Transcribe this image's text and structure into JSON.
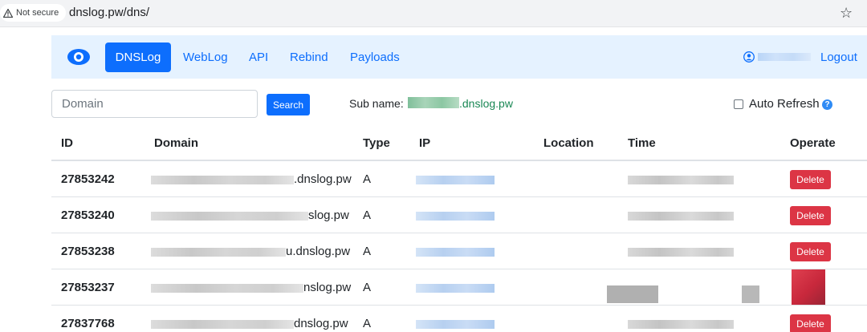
{
  "browser": {
    "security_label": "Not secure",
    "url": "dnslog.pw/dns/"
  },
  "navbar": {
    "brand_icon": "eye-icon",
    "active": "DNSLog",
    "links": [
      "WebLog",
      "API",
      "Rebind",
      "Payloads"
    ],
    "logout": "Logout",
    "accent": "#0d6efd",
    "background": "#e5f2ff"
  },
  "search": {
    "placeholder": "Domain",
    "value": "",
    "button": "Search",
    "sub_name_label": "Sub name:",
    "sub_name_domain": ".dnslog.pw",
    "auto_refresh_label": "Auto Refresh",
    "auto_refresh_checked": false
  },
  "table": {
    "headers": [
      "ID",
      "Domain",
      "Type",
      "IP",
      "Location",
      "Time",
      "Operate"
    ],
    "rows": [
      {
        "id": "27853242",
        "domain_suffix": ".dnslog.pw",
        "type": "A",
        "delete": "Delete"
      },
      {
        "id": "27853240",
        "domain_suffix": "slog.pw",
        "type": "A",
        "delete": "Delete"
      },
      {
        "id": "27853238",
        "domain_suffix": "u.dnslog.pw",
        "type": "A",
        "delete": "Delete"
      },
      {
        "id": "27853237",
        "domain_suffix": "nslog.pw",
        "type": "A",
        "delete": ""
      },
      {
        "id": "27837768",
        "domain_suffix": "dnslog.pw",
        "type": "A",
        "delete": "Delete"
      }
    ],
    "danger_color": "#dc3545"
  }
}
